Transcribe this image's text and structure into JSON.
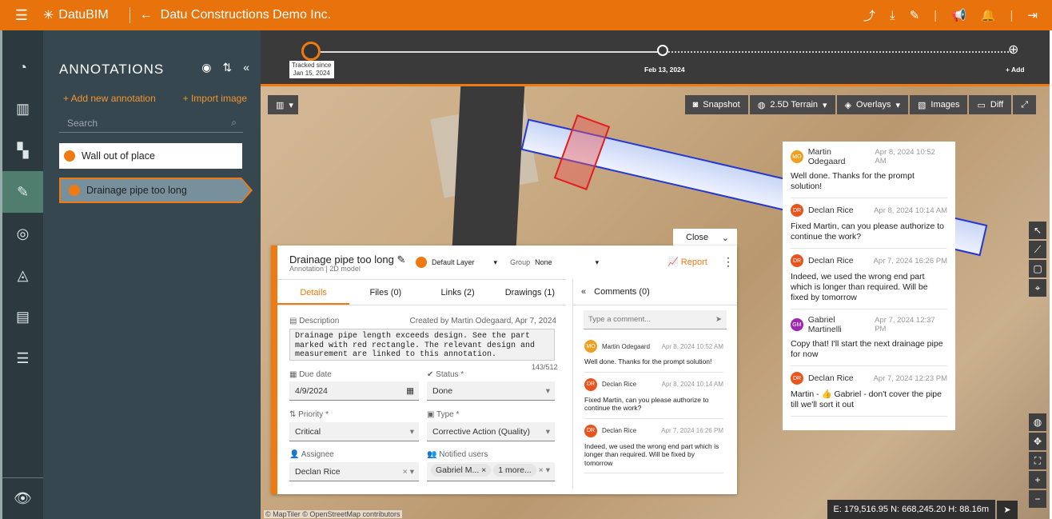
{
  "header": {
    "brand": "DatuBIM",
    "title": "Datu Constructions Demo Inc."
  },
  "sidebar": {
    "title": "ANNOTATIONS",
    "add_new": "+ Add new annotation",
    "import_image": "+ Import image",
    "search_placeholder": "Search",
    "items": [
      {
        "label": "Wall out of place"
      },
      {
        "label": "Drainage pipe too long"
      }
    ]
  },
  "timeline": {
    "tracked_since": "Tracked since",
    "tracked_date": "Jan 15, 2024",
    "current": "Feb 13, 2024",
    "add": "+ Add"
  },
  "map_tools": {
    "snapshot": "Snapshot",
    "terrain": "2.5D Terrain",
    "overlays": "Overlays",
    "images": "Images",
    "diff": "Diff"
  },
  "coords": "E: 179,516.95  N: 668,245.20  H: 88.16m",
  "attribution": "© MapTiler © OpenStreetMap contributors",
  "comment_panel": [
    {
      "initials": "MO",
      "name": "Martin Odegaard",
      "time": "Apr 8, 2024 10:52 AM",
      "text": "Well done. Thanks for the prompt solution!",
      "color": "#f0a020"
    },
    {
      "initials": "DR",
      "name": "Declan Rice",
      "time": "Apr 8, 2024 10:14 AM",
      "text": "Fixed Martin, can you please authorize to continue the work?",
      "color": "#e8541e"
    },
    {
      "initials": "DR",
      "name": "Declan Rice",
      "time": "Apr 7, 2024 16:26 PM",
      "text": "Indeed, we used the wrong end part which is longer than required. Will be fixed by tomorrow",
      "color": "#e8541e"
    },
    {
      "initials": "GM",
      "name": "Gabriel Martinelli",
      "time": "Apr 7, 2024 12:37 PM",
      "text": "Copy that! I'll start the next drainage pipe for now",
      "color": "#9c27b0"
    },
    {
      "initials": "DR",
      "name": "Declan Rice",
      "time": "Apr 7, 2024 12:23 PM",
      "text": "Martin - 👍 Gabriel - don't cover the pipe till we'll sort it out",
      "color": "#e8541e"
    }
  ],
  "detail": {
    "close": "Close",
    "title": "Drainage pipe too long",
    "subtitle": "Annotation | 2D model",
    "layer": "Default Layer",
    "group_label": "Group",
    "group": "None",
    "report": "Report",
    "tabs": [
      "Details",
      "Files (0)",
      "Links (2)",
      "Drawings (1)"
    ],
    "description_label": "Description",
    "created": "Created by Martin Odegaard,  Apr 7, 2024",
    "description": "Drainage pipe length exceeds design. See the part marked with red rectangle. The relevant design and measurement are linked to this annotation.",
    "char_count": "143/512",
    "due_label": "Due date",
    "due": "4/9/2024",
    "status_label": "Status *",
    "status": "Done",
    "priority_label": "Priority *",
    "priority": "Critical",
    "type_label": "Type *",
    "type": "Corrective Action (Quality)",
    "assignee_label": "Assignee",
    "assignee": "Declan Rice",
    "notified_label": "Notified users",
    "notified": "Gabriel M...",
    "notified_more": "1 more...",
    "comments_title": "Comments (0)",
    "comment_placeholder": "Type a comment...",
    "comments": [
      {
        "initials": "MO",
        "name": "Martin Odegaard",
        "time": "Apr 8, 2024 10:52 AM",
        "text": "Well done. Thanks for the prompt solution!",
        "color": "#f0a020"
      },
      {
        "initials": "DR",
        "name": "Declan Rice",
        "time": "Apr 8, 2024 10:14 AM",
        "text": "Fixed Martin, can you please authorize to continue the work?",
        "color": "#e8541e"
      },
      {
        "initials": "DR",
        "name": "Declan Rice",
        "time": "Apr 7, 2024 16:26 PM",
        "text": "Indeed, we used the wrong end part which is longer than required. Will be fixed by tomorrow",
        "color": "#e8541e"
      }
    ]
  }
}
